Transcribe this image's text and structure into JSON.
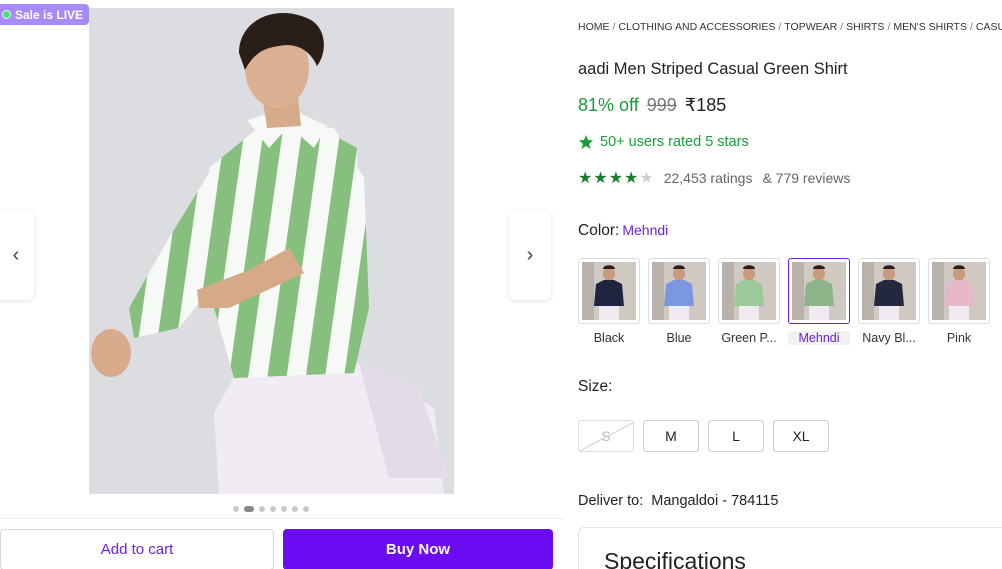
{
  "gallery": {
    "sale_badge": "Sale is LIVE",
    "prev_arrow": "‹",
    "next_arrow": "›",
    "dot_count": 7,
    "active_dot": 1
  },
  "actions": {
    "add_to_cart": "Add to cart",
    "buy_now": "Buy Now"
  },
  "breadcrumb": [
    "HOME",
    "CLOTHING AND ACCESSORIES",
    "TOPWEAR",
    "SHIRTS",
    "MEN'S SHIRTS",
    "CASUAL S"
  ],
  "product": {
    "title": "aadi Men Striped Casual Green Shirt",
    "discount": "81% off",
    "mrp": "999",
    "price": "₹185",
    "rated_badge": "50+ users rated 5 stars",
    "stars": 4,
    "ratings": "22,453 ratings",
    "reviews": "& 779 reviews"
  },
  "color": {
    "label": "Color:",
    "selected": "Mehndi",
    "options": [
      {
        "name": "Black",
        "shirt": "#1f2540"
      },
      {
        "name": "Blue",
        "shirt": "#7a97e0"
      },
      {
        "name": "Green P...",
        "shirt": "#9bc99a"
      },
      {
        "name": "Mehndi",
        "shirt": "#8fb48a"
      },
      {
        "name": "Navy Bl...",
        "shirt": "#24283f"
      },
      {
        "name": "Pink",
        "shirt": "#e7b8c8"
      }
    ]
  },
  "size": {
    "label": "Size:",
    "options": [
      {
        "name": "S",
        "available": false
      },
      {
        "name": "M",
        "available": true
      },
      {
        "name": "L",
        "available": true
      },
      {
        "name": "XL",
        "available": true
      }
    ]
  },
  "delivery": {
    "label": "Deliver to:",
    "location": "Mangaldoi - 784115"
  },
  "specifications": {
    "title": "Specifications"
  },
  "colors": {
    "accent": "#6c0af2",
    "green": "#1a9c3b"
  }
}
